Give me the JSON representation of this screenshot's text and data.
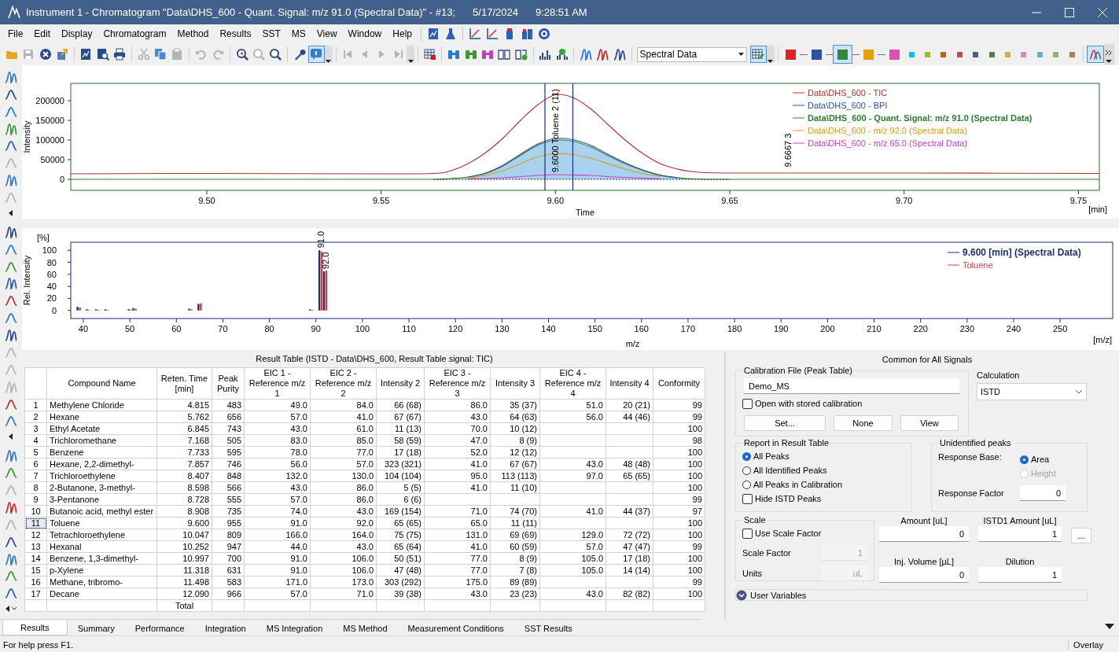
{
  "window": {
    "title": "Instrument 1 - Chromatogram \"Data\\DHS_600 - Quant. Signal: m/z 91.0 (Spectral Data)\" - #13;",
    "date": "5/17/2024",
    "time": "9:28:51 AM"
  },
  "menu": [
    "File",
    "Edit",
    "Display",
    "Chromatogram",
    "Method",
    "Results",
    "SST",
    "MS",
    "View",
    "Window",
    "Help"
  ],
  "toolbar": {
    "buttons": [
      {
        "disabled": false,
        "pressed": false
      },
      {
        "disabled": true,
        "pressed": false
      },
      {
        "disabled": false,
        "pressed": false
      },
      {
        "disabled": false,
        "pressed": false
      },
      {
        "disabled": false,
        "pressed": false
      },
      {
        "disabled": false,
        "pressed": false
      },
      {
        "disabled": false,
        "pressed": false
      },
      {
        "disabled": true,
        "pressed": false
      },
      {
        "disabled": false,
        "pressed": false
      },
      {
        "disabled": true,
        "pressed": false
      },
      {
        "disabled": true,
        "pressed": false
      },
      {
        "disabled": true,
        "pressed": false
      },
      {
        "disabled": false,
        "pressed": false
      },
      {
        "disabled": true,
        "pressed": false
      },
      {
        "disabled": false,
        "pressed": false
      },
      {
        "disabled": false,
        "pressed": false
      },
      {
        "disabled": false,
        "pressed": true
      },
      {
        "disabled": true,
        "pressed": false
      },
      {
        "disabled": true,
        "pressed": false
      },
      {
        "disabled": true,
        "pressed": false
      },
      {
        "disabled": true,
        "pressed": false
      },
      {
        "disabled": false,
        "pressed": false
      },
      {
        "disabled": false,
        "pressed": false
      },
      {
        "disabled": false,
        "pressed": false
      },
      {
        "disabled": false,
        "pressed": false
      },
      {
        "disabled": false,
        "pressed": false
      },
      {
        "disabled": false,
        "pressed": false
      },
      {
        "disabled": false,
        "pressed": false
      },
      {
        "disabled": false,
        "pressed": false
      },
      {
        "disabled": false,
        "pressed": false
      },
      {
        "disabled": false,
        "pressed": false
      },
      {
        "disabled": false,
        "pressed": false
      },
      {
        "disabled": false,
        "pressed": true
      },
      {
        "disabled": false,
        "pressed": true
      }
    ],
    "signal_select": "Spectral Data",
    "colors": [
      {
        "color": "#e02222",
        "linked": true,
        "selected": false
      },
      {
        "color": "#3050a0",
        "linked": true,
        "selected": false
      },
      {
        "color": "#2e8b3a",
        "linked": true,
        "selected": true
      },
      {
        "color": "#e0a010",
        "linked": true,
        "selected": false
      },
      {
        "color": "#e050b0",
        "linked": true,
        "selected": false
      },
      {
        "color": "#20b8e0",
        "linked": false,
        "selected": false
      },
      {
        "color": "#98b840",
        "linked": false,
        "selected": false
      },
      {
        "color": "#a86a28",
        "linked": false,
        "selected": false
      },
      {
        "color": "#c84848",
        "linked": false,
        "selected": false
      },
      {
        "color": "#485a98",
        "linked": false,
        "selected": false
      },
      {
        "color": "#5a7858",
        "linked": false,
        "selected": false
      },
      {
        "color": "#c8b050",
        "linked": false,
        "selected": false
      },
      {
        "color": "#e088b8",
        "linked": false,
        "selected": false
      },
      {
        "color": "#68b0d0",
        "linked": false,
        "selected": false
      },
      {
        "color": "#98b058",
        "linked": false,
        "selected": false
      },
      {
        "color": "#a88058",
        "linked": false,
        "selected": false
      }
    ]
  },
  "side_tools": [
    [
      {
        "disabled": false
      },
      {
        "disabled": false
      },
      {
        "disabled": false
      },
      {
        "disabled": false
      },
      {
        "disabled": false
      },
      {
        "disabled": true
      },
      {
        "disabled": false
      },
      {
        "disabled": true
      }
    ],
    [
      {
        "disabled": false
      },
      {
        "disabled": false
      },
      {
        "disabled": false
      },
      {
        "disabled": false
      },
      {
        "disabled": false
      },
      {
        "disabled": false
      },
      {
        "disabled": false
      },
      {
        "disabled": true
      },
      {
        "disabled": true
      },
      {
        "disabled": true
      },
      {
        "disabled": false
      },
      {
        "disabled": false
      }
    ],
    [
      {
        "disabled": false
      },
      {
        "disabled": false
      },
      {
        "disabled": true
      },
      {
        "disabled": false
      },
      {
        "disabled": true
      },
      {
        "disabled": false
      },
      {
        "disabled": false
      },
      {
        "disabled": false
      },
      {
        "disabled": false
      }
    ]
  ],
  "chromatogram": {
    "x_unit": "[min]",
    "series_styles": [
      {
        "bold": false,
        "filled": false
      },
      {
        "bold": false,
        "filled": false
      },
      {
        "bold": true,
        "filled": true
      },
      {
        "bold": false,
        "filled": false
      },
      {
        "bold": false,
        "filled": false
      }
    ],
    "chart_data": {
      "type": "line",
      "xlabel": "Time",
      "ylabel": "Intensity",
      "x": [
        9.461,
        9.5,
        9.55,
        9.565,
        9.57,
        9.575,
        9.58,
        9.585,
        9.59,
        9.595,
        9.6,
        9.605,
        9.61,
        9.615,
        9.62,
        9.625,
        9.63,
        9.635,
        9.64,
        9.65,
        9.7,
        9.756
      ],
      "series": [
        {
          "name": "Data\\DHS_600 - TIC",
          "color": "#b03030",
          "values": [
            14000,
            15000,
            14000,
            15000,
            22000,
            40000,
            68000,
            105000,
            150000,
            190000,
            215000,
            208000,
            180000,
            140000,
            100000,
            66000,
            40000,
            26000,
            19000,
            16000,
            16000,
            15000
          ]
        },
        {
          "name": "Data\\DHS_600 - BPI",
          "color": "#3050a0",
          "values": [
            null,
            null,
            null,
            null,
            null,
            6000,
            16000,
            36000,
            64000,
            90000,
            104000,
            101000,
            87000,
            64000,
            42000,
            24000,
            11000,
            4000,
            null,
            null,
            null,
            null
          ]
        },
        {
          "name": "Data\\DHS_600 - Quant. Signal: m/z 91.0 (Spectral Data)",
          "color": "#2e7d32",
          "values": [
            0,
            0,
            0,
            0,
            2000,
            6000,
            15000,
            34000,
            61000,
            87000,
            100000,
            97000,
            83000,
            61000,
            40000,
            23000,
            10000,
            4000,
            1000,
            0,
            0,
            0
          ]
        },
        {
          "name": "Data\\DHS_600 - m/z 92.0 (Spectral Data)",
          "color": "#d4a017",
          "values": [
            null,
            null,
            null,
            null,
            null,
            4000,
            10000,
            22000,
            40000,
            57000,
            65000,
            63000,
            54000,
            40000,
            26000,
            15000,
            7000,
            null,
            null,
            null,
            null,
            null
          ]
        },
        {
          "name": "Data\\DHS_600 - m/z 65.0 (Spectral Data)",
          "color": "#d040c0",
          "values": [
            null,
            null,
            null,
            null,
            null,
            1000,
            2000,
            4000,
            7000,
            10000,
            12000,
            11000,
            10000,
            7000,
            5000,
            3000,
            1000,
            null,
            null,
            null,
            null,
            null
          ]
        }
      ],
      "xlim": [
        9.461,
        9.756
      ],
      "ylim": [
        -28000,
        244000
      ],
      "xticks": [
        {
          "value": 9.5,
          "label": "9.50"
        },
        {
          "value": 9.55,
          "label": "9.55"
        },
        {
          "value": 9.6,
          "label": "9.60"
        },
        {
          "value": 9.65,
          "label": "9.65"
        },
        {
          "value": 9.7,
          "label": "9.70"
        },
        {
          "value": 9.75,
          "label": "9.75"
        }
      ],
      "yticks": [
        0,
        50000,
        100000,
        150000,
        200000
      ],
      "legend": true,
      "ref_lines": [
        {
          "axis": "x",
          "value": 9.597
        },
        {
          "axis": "x",
          "value": 9.605
        },
        {
          "axis": "y",
          "value": 0
        }
      ],
      "annotations": [
        {
          "x": 9.6,
          "y": 12000,
          "text": "9.6000 Toluene 2 (11)"
        },
        {
          "x": 9.6667,
          "y": 25000,
          "text": "9.6667 3"
        }
      ]
    }
  },
  "spectrum": {
    "x_unit": "[m/z]",
    "y_unit": "[%]",
    "series_styles": [
      {
        "bold": true
      },
      {
        "bold": false
      }
    ],
    "chart_data": {
      "type": "bar",
      "xlabel": "m/z",
      "ylabel": "Rel. Intensity",
      "x": [
        39,
        41,
        43,
        45,
        50,
        51,
        63,
        65,
        89,
        91,
        92
      ],
      "series": [
        {
          "name": "9.600 [min] (Spectral Data)",
          "color": "#1f2f6f",
          "values": [
            6,
            2,
            2,
            2,
            2,
            4,
            3,
            11,
            2,
            100,
            65
          ]
        },
        {
          "name": "Toluene",
          "color": "#d04040",
          "values": [
            5,
            1,
            1,
            1,
            1,
            3,
            2,
            12,
            1,
            98,
            66
          ]
        }
      ],
      "xlim": [
        37.3,
        261.3
      ],
      "ylim": [
        -13.4,
        113.4
      ],
      "xticks": [
        40,
        50,
        60,
        70,
        80,
        90,
        100,
        110,
        120,
        130,
        140,
        150,
        160,
        170,
        180,
        190,
        200,
        210,
        220,
        230,
        240,
        250
      ],
      "yticks": [
        0,
        20,
        40,
        60,
        80,
        100
      ],
      "legend": true,
      "annotations": [
        {
          "x": 91,
          "y": 100,
          "text": "91.0"
        },
        {
          "x": 92,
          "y": 65,
          "text": "92.0"
        }
      ]
    }
  },
  "result_table": {
    "caption": "Result Table (ISTD - Data\\DHS_600, Result Table signal: TIC)",
    "columns": [
      "Compound Name",
      "Reten. Time [min]",
      "Peak Purity",
      "EIC 1 - Reference m/z 1",
      "EIC 2 - Reference m/z 2",
      "Intensity 2",
      "EIC 3 - Reference m/z 3",
      "Intensity 3",
      "EIC 4 - Reference m/z 4",
      "Intensity 4",
      "Conformity"
    ],
    "rows": [
      {
        "number": "1",
        "selected": false,
        "cells": [
          "Methylene Chloride",
          "4.815",
          "483",
          "49.0",
          "84.0",
          "66 (68)",
          "86.0",
          "35 (37)",
          "51.0",
          "20 (21)",
          "99"
        ]
      },
      {
        "number": "2",
        "selected": false,
        "cells": [
          "Hexane",
          "5.762",
          "656",
          "57.0",
          "41.0",
          "67 (67)",
          "43.0",
          "64 (63)",
          "56.0",
          "44 (46)",
          "99"
        ]
      },
      {
        "number": "3",
        "selected": false,
        "cells": [
          "Ethyl Acetate",
          "6.845",
          "743",
          "43.0",
          "61.0",
          "11 (13)",
          "70.0",
          "10 (12)",
          null,
          null,
          "100"
        ]
      },
      {
        "number": "4",
        "selected": false,
        "cells": [
          "Trichloromethane",
          "7.168",
          "505",
          "83.0",
          "85.0",
          "58 (59)",
          "47.0",
          "8 (9)",
          null,
          null,
          "98"
        ]
      },
      {
        "number": "5",
        "selected": false,
        "cells": [
          "Benzene",
          "7.733",
          "595",
          "78.0",
          "77.0",
          "17 (18)",
          "52.0",
          "12 (12)",
          null,
          null,
          "100"
        ]
      },
      {
        "number": "6",
        "selected": false,
        "cells": [
          "Hexane, 2,2-dimethyl-",
          "7.857",
          "746",
          "56.0",
          "57.0",
          "323 (321)",
          "41.0",
          "67 (67)",
          "43.0",
          "48 (48)",
          "100"
        ]
      },
      {
        "number": "7",
        "selected": false,
        "cells": [
          "Trichloroethylene",
          "8.407",
          "848",
          "132.0",
          "130.0",
          "104 (104)",
          "95.0",
          "113 (113)",
          "97.0",
          "65 (65)",
          "100"
        ]
      },
      {
        "number": "8",
        "selected": false,
        "cells": [
          "2-Butanone, 3-methyl-",
          "8.598",
          "566",
          "43.0",
          "86.0",
          "5 (5)",
          "41.0",
          "11 (10)",
          null,
          null,
          "100"
        ]
      },
      {
        "number": "9",
        "selected": false,
        "cells": [
          "3-Pentanone",
          "8.728",
          "555",
          "57.0",
          "86.0",
          "6 (6)",
          null,
          null,
          null,
          null,
          "99"
        ]
      },
      {
        "number": "10",
        "selected": false,
        "cells": [
          "Butanoic acid, methyl ester",
          "8.908",
          "735",
          "74.0",
          "43.0",
          "169 (154)",
          "71.0",
          "74 (70)",
          "41.0",
          "44 (37)",
          "97"
        ]
      },
      {
        "number": "11",
        "selected": true,
        "cells": [
          "Toluene",
          "9.600",
          "955",
          "91.0",
          "92.0",
          "65 (65)",
          "65.0",
          "11 (11)",
          null,
          null,
          "100"
        ]
      },
      {
        "number": "12",
        "selected": false,
        "cells": [
          "Tetrachloroethylene",
          "10.047",
          "809",
          "166.0",
          "164.0",
          "75 (75)",
          "131.0",
          "69 (69)",
          "129.0",
          "72 (72)",
          "100"
        ]
      },
      {
        "number": "13",
        "selected": false,
        "cells": [
          "Hexanal",
          "10.252",
          "947",
          "44.0",
          "43.0",
          "65 (64)",
          "41.0",
          "60 (59)",
          "57.0",
          "47 (47)",
          "99"
        ]
      },
      {
        "number": "14",
        "selected": false,
        "cells": [
          "Benzene, 1,3-dimethyl-",
          "10.997",
          "700",
          "91.0",
          "106.0",
          "50 (51)",
          "77.0",
          "8 (9)",
          "105.0",
          "17 (18)",
          "100"
        ]
      },
      {
        "number": "15",
        "selected": false,
        "cells": [
          "p-Xylene",
          "11.318",
          "631",
          "91.0",
          "106.0",
          "47 (48)",
          "77.0",
          "7 (8)",
          "105.0",
          "14 (14)",
          "100"
        ]
      },
      {
        "number": "16",
        "selected": false,
        "cells": [
          "Methane, tribromo-",
          "11.498",
          "583",
          "171.0",
          "173.0",
          "303 (292)",
          "175.0",
          "89 (89)",
          null,
          null,
          "99"
        ]
      },
      {
        "number": "17",
        "selected": false,
        "cells": [
          "Decane",
          "12.090",
          "966",
          "57.0",
          "71.0",
          "39 (38)",
          "43.0",
          "23 (23)",
          "43.0",
          "82 (82)",
          "100"
        ]
      }
    ],
    "total": "Total"
  },
  "common_panel": {
    "title": "Common for All Signals",
    "calibration": {
      "legend": "Calibration File (Peak Table)",
      "file": "Demo_MS",
      "open_with_stored": {
        "label": "Open with stored calibration",
        "checked": false
      },
      "buttons": [
        "Set...",
        "None",
        "View"
      ]
    },
    "calculation": {
      "label": "Calculation",
      "value": "ISTD"
    },
    "report": {
      "legend": "Report in Result Table",
      "options": [
        {
          "label": "All Peaks",
          "selected": true
        },
        {
          "label": "All Identified Peaks",
          "selected": false
        },
        {
          "label": "All Peaks in Calibration",
          "selected": false
        }
      ],
      "hide_istd": {
        "label": "Hide ISTD Peaks",
        "checked": false
      }
    },
    "unidentified": {
      "legend": "Unidentified peaks",
      "response_base_label": "Response Base:",
      "bases": [
        {
          "label": "Area",
          "selected": true,
          "disabled": false
        },
        {
          "label": "Height",
          "selected": false,
          "disabled": true
        }
      ],
      "response_factor_label": "Response Factor",
      "response_factor": "0"
    },
    "scale": {
      "legend": "Scale",
      "use_scale": {
        "label": "Use Scale Factor",
        "checked": false
      },
      "fields": [
        {
          "label": "Scale Factor",
          "value": "1",
          "disabled": true
        },
        {
          "label": "Units",
          "value": "uL",
          "disabled": true
        }
      ]
    },
    "amounts": [
      {
        "label": "Amount [uL]",
        "value": "0"
      },
      {
        "label": "ISTD1 Amount [uL]",
        "value": "1"
      },
      {
        "label": "Inj. Volume [µL]",
        "value": "0"
      },
      {
        "label": "Dilution",
        "value": "1"
      }
    ],
    "more_button": "...",
    "user_variables": {
      "label": "User Variables",
      "expanded": false
    }
  },
  "tabs": [
    {
      "label": "Results",
      "selected": true
    },
    {
      "label": "Summary",
      "selected": false
    },
    {
      "label": "Performance",
      "selected": false
    },
    {
      "label": "Integration",
      "selected": false
    },
    {
      "label": "MS Integration",
      "selected": false
    },
    {
      "label": "MS Method",
      "selected": false
    },
    {
      "label": "Measurement Conditions",
      "selected": false
    },
    {
      "label": "SST Results",
      "selected": false
    }
  ],
  "status_bar": {
    "help": "For help press F1.",
    "mode": "Overlay"
  }
}
